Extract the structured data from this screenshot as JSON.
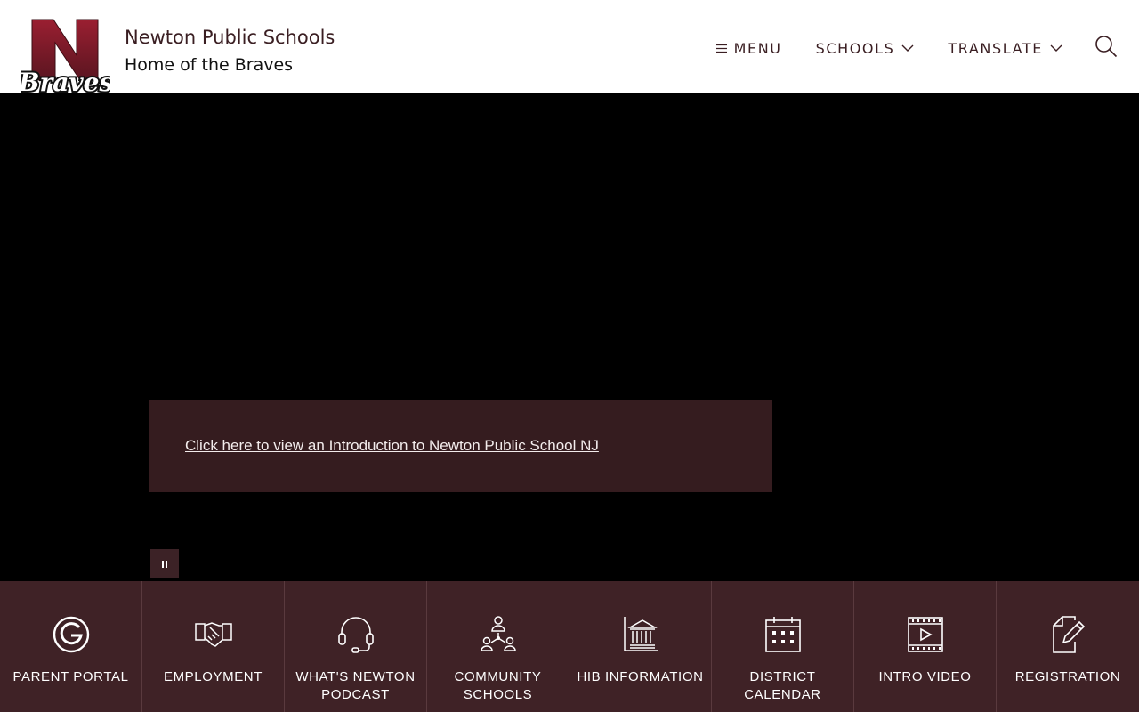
{
  "header": {
    "logo_text_n": "N",
    "logo_text_script": "Braves",
    "site_name": "Newton Public Schools",
    "tagline": "Home of the Braves"
  },
  "nav": {
    "menu": "MENU",
    "schools": "SCHOOLS",
    "translate": "TRANSLATE",
    "search_icon": "search-icon"
  },
  "hero": {
    "intro_link": "Click here to view an Introduction to Newton Public School NJ"
  },
  "quicklinks": [
    {
      "label_1": "PARENT PORTAL",
      "label_2": "",
      "icon": "genesis-g-icon"
    },
    {
      "label_1": "EMPLOYMENT",
      "label_2": "",
      "icon": "handshake-icon"
    },
    {
      "label_1": "WHAT'S NEWTON",
      "label_2": "PODCAST",
      "icon": "headset-icon"
    },
    {
      "label_1": "COMMUNITY",
      "label_2": "SCHOOLS",
      "icon": "community-icon"
    },
    {
      "label_1": "HIB INFORMATION",
      "label_2": "",
      "icon": "bank-building-icon"
    },
    {
      "label_1": "DISTRICT",
      "label_2": "CALENDAR",
      "icon": "calendar-icon"
    },
    {
      "label_1": "INTRO VIDEO",
      "label_2": "",
      "icon": "video-icon"
    },
    {
      "label_1": "REGISTRATION",
      "label_2": "",
      "icon": "edit-document-icon"
    }
  ],
  "colors": {
    "brand": "#3f2226",
    "brand_dark": "#351c1f",
    "logo_red": "#8a1c2b"
  }
}
